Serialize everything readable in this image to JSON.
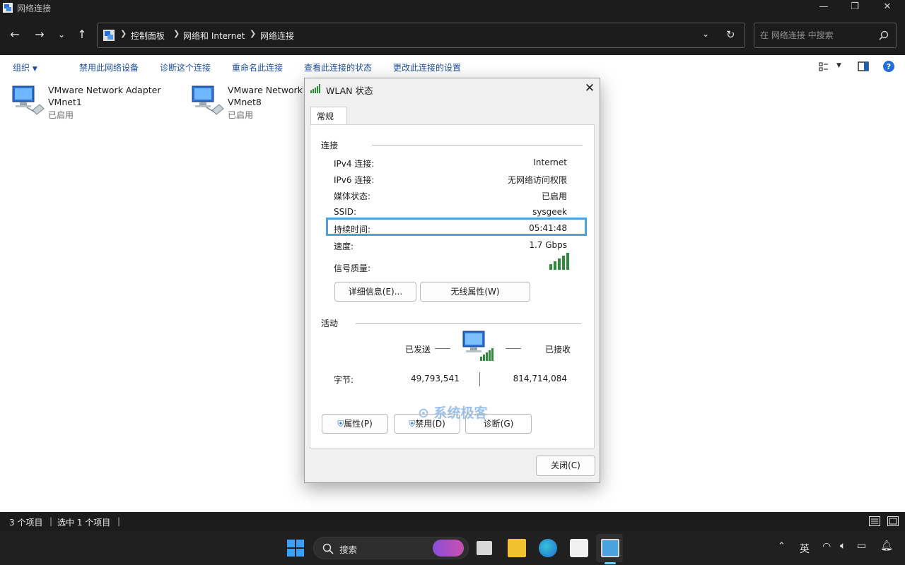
{
  "window": {
    "title": "网络连接"
  },
  "nav": {
    "breadcrumb": [
      "控制面板",
      "网络和 Internet",
      "网络连接"
    ],
    "search_placeholder": "在 网络连接 中搜索"
  },
  "toolbar": {
    "organize": "组织",
    "actions": [
      "禁用此网络设备",
      "诊断这个连接",
      "重命名此连接",
      "查看此连接的状态",
      "更改此连接的设置"
    ]
  },
  "items": [
    {
      "name": "VMware Network Adapter",
      "sub": "VMnet1",
      "status": "已启用"
    },
    {
      "name": "VMware Network",
      "sub": "VMnet8",
      "status": "已启用"
    }
  ],
  "dialog": {
    "title": "WLAN 状态",
    "tab": "常规",
    "connection": {
      "heading": "连接",
      "rows": [
        {
          "label": "IPv4 连接:",
          "value": "Internet"
        },
        {
          "label": "IPv6 连接:",
          "value": "无网络访问权限"
        },
        {
          "label": "媒体状态:",
          "value": "已启用"
        },
        {
          "label": "SSID:",
          "value": "sysgeek"
        },
        {
          "label": "持续时间:",
          "value": "05:41:48"
        },
        {
          "label": "速度:",
          "value": "1.7 Gbps"
        },
        {
          "label": "信号质量:",
          "value": ""
        }
      ],
      "signal_bars": 5
    },
    "details_button": "详细信息(E)...",
    "wireless_button": "无线属性(W)",
    "activity": {
      "heading": "活动",
      "sent_label": "已发送",
      "received_label": "已接收",
      "bytes_label": "字节:",
      "sent_bytes": "49,793,541",
      "received_bytes": "814,714,084"
    },
    "properties_button": "属性(P)",
    "disable_button": "禁用(D)",
    "diagnose_button": "诊断(G)",
    "close_button": "关闭(C)",
    "watermark": "系统极客"
  },
  "statusbar": {
    "count": "3 个项目",
    "selected": "选中 1 个项目"
  },
  "taskbar": {
    "search_label": "搜索",
    "ime": "英"
  },
  "colors": {
    "dark": "#1c1c1c",
    "highlight": "#4aa3df",
    "link": "#1f4fa0"
  }
}
